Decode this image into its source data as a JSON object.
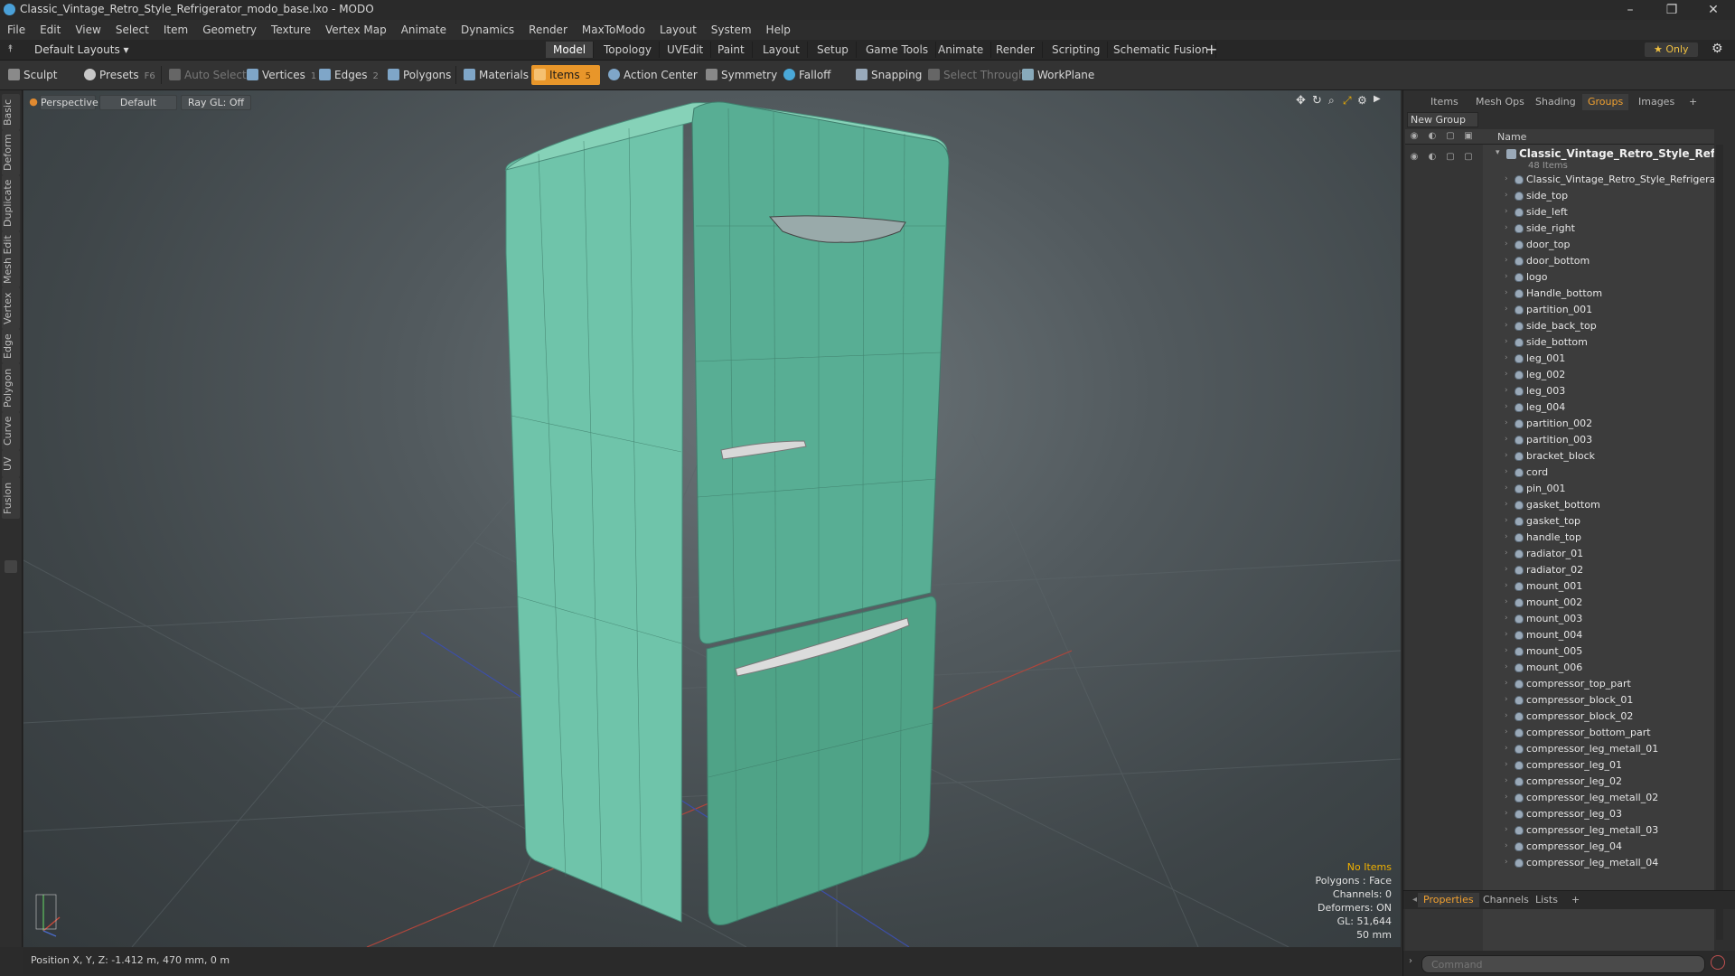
{
  "window": {
    "title": "Classic_Vintage_Retro_Style_Refrigerator_modo_base.lxo - MODO",
    "controls": [
      "–",
      "❐",
      "✕"
    ]
  },
  "menu": [
    "File",
    "Edit",
    "View",
    "Select",
    "Item",
    "Geometry",
    "Texture",
    "Vertex Map",
    "Animate",
    "Dynamics",
    "Render",
    "MaxToModo",
    "Layout",
    "System",
    "Help"
  ],
  "layoutbar": {
    "layouts_label": "Default Layouts ▾",
    "tabs": [
      "Model",
      "Topology",
      "UVEdit",
      "Paint",
      "Layout",
      "Setup",
      "Game Tools",
      "Animate",
      "Render",
      "Scripting",
      "Schematic Fusion"
    ],
    "active_tab": "Model",
    "add_label": "+",
    "only_label": "★ Only"
  },
  "toolbar": {
    "sculpt": "Sculpt",
    "presets": "Presets",
    "presets_key": "F6",
    "auto_select": "Auto Select",
    "vertices": "Vertices",
    "vertices_key": "1",
    "edges": "Edges",
    "edges_key": "2",
    "polygons": "Polygons",
    "materials": "Materials",
    "items": "Items",
    "items_key": "5",
    "action_center": "Action Center",
    "symmetry": "Symmetry",
    "falloff": "Falloff",
    "snapping": "Snapping",
    "select_through": "Select Through",
    "workplane": "WorkPlane"
  },
  "left_tabs": [
    "Basic",
    "Deform",
    "Duplicate",
    "Mesh Edit",
    "Vertex",
    "Edge",
    "Polygon",
    "Curve",
    "UV",
    "Fusion"
  ],
  "viewport": {
    "view_mode": "Perspective",
    "shading": "Default",
    "raygl": "Ray GL: Off",
    "info": {
      "selection": "No Items",
      "polygons": "Polygons : Face",
      "channels": "Channels: 0",
      "deformers": "Deformers: ON",
      "gl": "GL: 51,644",
      "scale": "50 mm"
    },
    "colors": {
      "fridge": "#5fb8a0",
      "handle": "#d8d8d8"
    }
  },
  "status": {
    "position": "Position X, Y, Z:   -1.412 m, 470 mm, 0 m"
  },
  "right_panel": {
    "tabs": [
      "Items",
      "Mesh Ops",
      "Shading",
      "Groups",
      "Images",
      "+"
    ],
    "active_tab": "Groups",
    "new_group": "New Group",
    "column_name": "Name",
    "group": {
      "name": "Classic_Vintage_Retro_Style_Refrig...",
      "count": "48 Items"
    },
    "items": [
      "Classic_Vintage_Retro_Style_Refrigerator",
      "side_top",
      "side_left",
      "side_right",
      "door_top",
      "door_bottom",
      "logo",
      "Handle_bottom",
      "partition_001",
      "side_back_top",
      "side_bottom",
      "leg_001",
      "leg_002",
      "leg_003",
      "leg_004",
      "partition_002",
      "partition_003",
      "bracket_block",
      "cord",
      "pin_001",
      "gasket_bottom",
      "gasket_top",
      "handle_top",
      "radiator_01",
      "radiator_02",
      "mount_001",
      "mount_002",
      "mount_003",
      "mount_004",
      "mount_005",
      "mount_006",
      "compressor_top_part",
      "compressor_block_01",
      "compressor_block_02",
      "compressor_bottom_part",
      "compressor_leg_metall_01",
      "compressor_leg_01",
      "compressor_leg_02",
      "compressor_leg_metall_02",
      "compressor_leg_03",
      "compressor_leg_metall_03",
      "compressor_leg_04",
      "compressor_leg_metall_04"
    ],
    "bottom_tabs": [
      "Properties",
      "Channels",
      "Lists",
      "+"
    ],
    "bottom_active": "Properties",
    "command_placeholder": "Command"
  }
}
